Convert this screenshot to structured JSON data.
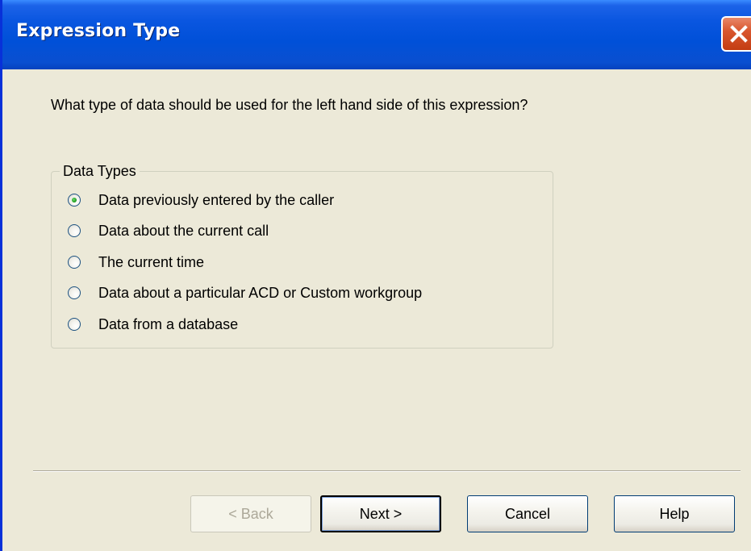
{
  "window": {
    "title": "Expression Type"
  },
  "question": "What type of data should be used for the left hand side of this expression?",
  "data_types": {
    "legend": "Data Types",
    "options": [
      {
        "label": "Data previously entered by the caller",
        "checked": true
      },
      {
        "label": "Data about the current call",
        "checked": false
      },
      {
        "label": "The current time",
        "checked": false
      },
      {
        "label": "Data about a particular ACD or Custom workgroup",
        "checked": false
      },
      {
        "label": "Data from a database",
        "checked": false
      }
    ]
  },
  "buttons": {
    "back": "< Back",
    "next": "Next >",
    "cancel": "Cancel",
    "help": "Help"
  },
  "colors": {
    "titlebar": "#0A56E0",
    "dialog_bg": "#ECE9D8",
    "close_button": "#D9572F",
    "selected_radio_dot": "#21A121"
  }
}
